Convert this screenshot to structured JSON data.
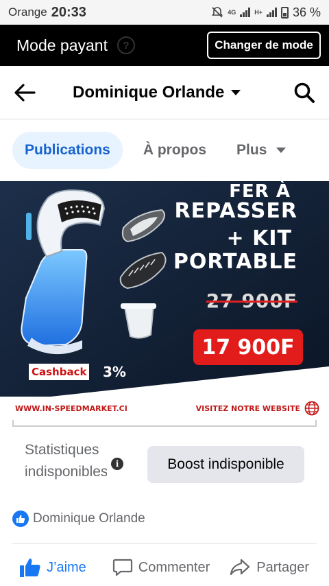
{
  "status_bar": {
    "carrier": "Orange",
    "time": "20:33",
    "network": "4G",
    "network_hplus": "H+",
    "battery": "36 %"
  },
  "mode_bar": {
    "title": "Mode payant",
    "change_label": "Changer de mode"
  },
  "header": {
    "title": "Dominique Orlande"
  },
  "tabs": [
    {
      "label": "Publications",
      "active": true
    },
    {
      "label": "À propos",
      "active": false
    },
    {
      "label": "Plus",
      "active": false
    }
  ],
  "ad": {
    "line1": "FER À",
    "line2": "REPASSER",
    "line3": "+ KIT",
    "line4": "PORTABLE",
    "old_price": "27 900F",
    "new_price": "17 900F",
    "cashback_label": "Cashback",
    "cashback_value": "3%",
    "website": "WWW.IN-SPEEDMARKET.CI",
    "visit_label": "VISITEZ NOTRE WEBSITE"
  },
  "stats": {
    "text": "Statistiques indisponibles",
    "boost_label": "Boost indisponible"
  },
  "reactions": {
    "name": "Dominique Orlande"
  },
  "actions": {
    "like": "J’aime",
    "comment": "Commenter",
    "share": "Partager"
  },
  "colors": {
    "accent": "#1877f2",
    "tab_active_bg": "#e7f3ff",
    "price_red": "#e21b1b",
    "mode_bar_bg": "#000000"
  }
}
